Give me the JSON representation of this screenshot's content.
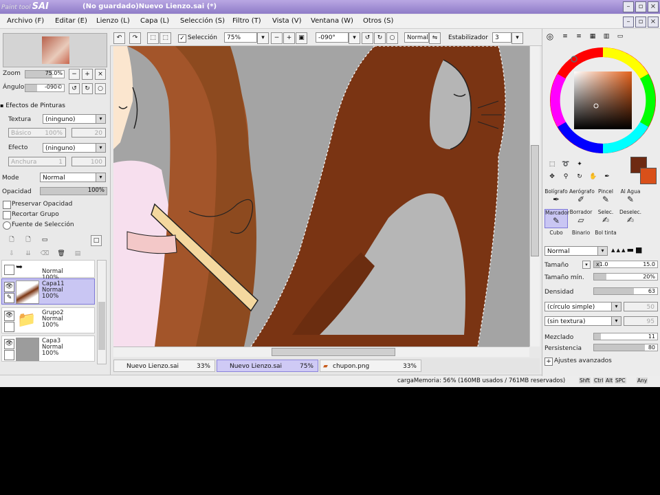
{
  "window": {
    "app_logo_small": "Paint tool",
    "app_logo": "SAI",
    "title": "(No guardado)Nuevo Lienzo.sai (*)"
  },
  "menu": [
    "Archivo (F)",
    "Editar (E)",
    "Lienzo (L)",
    "Capa (L)",
    "Selección (S)",
    "Filtro (T)",
    "Vista (V)",
    "Ventana (W)",
    "Otros (S)"
  ],
  "toolbar": {
    "selection_label": "Selección",
    "zoom": "75%",
    "rotation": "-090°",
    "blend": "Normal",
    "stabilizer_label": "Estabilizador",
    "stabilizer_value": "3"
  },
  "navigator": {
    "zoom_label": "Zoom",
    "zoom_value": "75.0%",
    "angle_label": "Ángulo",
    "angle_value": "-090©"
  },
  "paint_effects": {
    "header": "Efectos de Pinturas",
    "texture_label": "Textura",
    "texture_value": "(ninguno)",
    "texture_sub": "Básico",
    "texture_sub_pct": "100%",
    "texture_sub_num": "20",
    "effect_label": "Efecto",
    "effect_value": "(ninguno)",
    "effect_sub": "Anchura",
    "effect_sub_num": "1",
    "effect_sub_max": "100"
  },
  "layer_props": {
    "mode_label": "Mode",
    "mode_value": "Normal",
    "opacity_label": "Opacidad",
    "opacity_value": "100%",
    "preserve_opacity": "Preservar Opacidad",
    "clip_group": "Recortar Grupo",
    "selection_source": "Fuente de Selección"
  },
  "layers": [
    {
      "name": "",
      "mode": "Normal",
      "opacity": "100%"
    },
    {
      "name": "Capa11",
      "mode": "Normal",
      "opacity": "100%"
    },
    {
      "name": "Grupo2",
      "mode": "Normal",
      "opacity": "100%"
    },
    {
      "name": "Capa3",
      "mode": "Normal",
      "opacity": "100%"
    }
  ],
  "tabs": [
    {
      "label": "Nuevo Lienzo.sai",
      "pct": "33%"
    },
    {
      "label": "Nuevo Lienzo.sai",
      "pct": "75%"
    },
    {
      "label": "chupon.png",
      "pct": "33%"
    }
  ],
  "status": {
    "memory": "cargaMemoria: 56% (160MB usados / 761MB reservados)",
    "keys": [
      "Shft",
      "Ctrl",
      "Alt",
      "SPC",
      "Any"
    ]
  },
  "tools": {
    "row1": [
      "Bolígrafo",
      "Aerógrafo",
      "Pincel",
      "Al Agua"
    ],
    "row2": [
      "Marcador",
      "Borrador",
      "Selec.",
      "Deselec."
    ],
    "row3": [
      "Cubo",
      "Binario",
      "Bol tinta"
    ]
  },
  "brush": {
    "mode": "Normal",
    "size_label": "Tamaño",
    "size_mult": "x1.0",
    "size_value": "15.0",
    "min_size_label": "Tamaño mín.",
    "min_size_value": "20%",
    "density_label": "Densidad",
    "density_value": "63",
    "shape": "(círculo simple)",
    "shape_num": "50",
    "texture": "(sin textura)",
    "texture_num": "95",
    "blend_label": "Mezclado",
    "blend_value": "11",
    "persist_label": "Persistencia",
    "persist_value": "80",
    "advanced": "Ajustes avanzados"
  },
  "colors": {
    "primary": "#6e2a12",
    "secondary": "#d9501a",
    "accent": "#8b79cf"
  }
}
